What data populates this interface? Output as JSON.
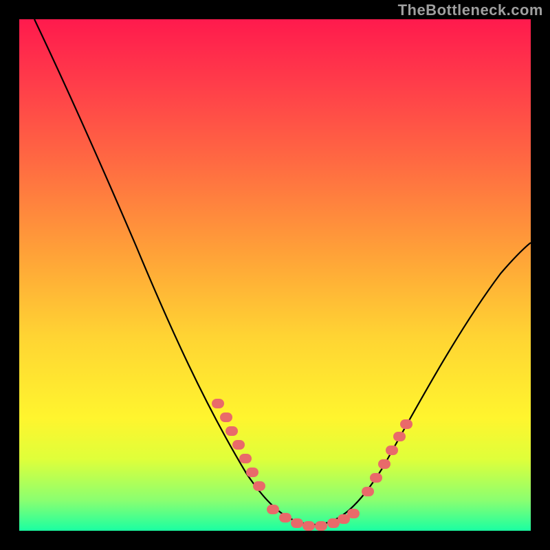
{
  "watermark": "TheBottleneck.com",
  "chart_data": {
    "type": "line",
    "title": "",
    "xlabel": "",
    "ylabel": "",
    "xlim": [
      0,
      100
    ],
    "ylim": [
      0,
      100
    ],
    "grid": false,
    "legend": false,
    "background_gradient": {
      "direction": "vertical",
      "stops": [
        {
          "pos": 0,
          "color": "#ff1a4d"
        },
        {
          "pos": 12,
          "color": "#ff3b4a"
        },
        {
          "pos": 28,
          "color": "#ff6a42"
        },
        {
          "pos": 46,
          "color": "#ffa238"
        },
        {
          "pos": 62,
          "color": "#ffd433"
        },
        {
          "pos": 78,
          "color": "#fff52e"
        },
        {
          "pos": 86,
          "color": "#dfff3a"
        },
        {
          "pos": 94,
          "color": "#8bff70"
        },
        {
          "pos": 100,
          "color": "#1affa2"
        }
      ]
    },
    "series": [
      {
        "name": "bottleneck-curve",
        "color": "#000000",
        "x": [
          3,
          10,
          18,
          26,
          33,
          39,
          44,
          48,
          52,
          56,
          60,
          64,
          70,
          77,
          85,
          94,
          100
        ],
        "values": [
          100,
          85,
          69,
          53,
          38,
          26,
          16,
          8,
          3,
          1,
          1,
          3,
          9,
          19,
          33,
          48,
          56
        ]
      }
    ],
    "markers": {
      "name": "highlighted-points",
      "color": "#e96a6a",
      "shape": "rounded-rect",
      "clusters": [
        {
          "name": "left-arm",
          "x_range": [
            38,
            45
          ],
          "y_range": [
            10,
            26
          ],
          "count": 7
        },
        {
          "name": "trough",
          "x_range": [
            48,
            63
          ],
          "y_range": [
            0.5,
            4
          ],
          "count": 10
        },
        {
          "name": "right-arm",
          "x_range": [
            66,
            74
          ],
          "y_range": [
            6,
            20
          ],
          "count": 6
        }
      ]
    }
  }
}
